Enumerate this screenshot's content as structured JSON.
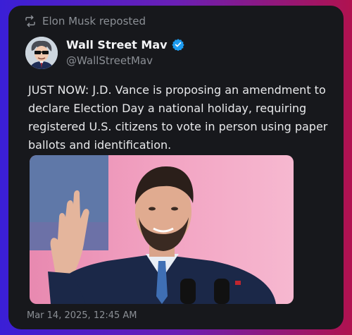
{
  "repost": {
    "label": "Elon Musk reposted",
    "icon": "repost-icon"
  },
  "author": {
    "name": "Wall Street Mav",
    "handle": "@WallStreetMav",
    "verified": true,
    "verified_color": "#1d9bf0"
  },
  "tweet": {
    "text": "JUST NOW: J.D. Vance is proposing an amendment to declare Election Day a national holiday, requiring registered U.S. citizens to vote in person using paper ballots and identification.",
    "timestamp": "Mar 14, 2025, 12:45 AM"
  },
  "colors": {
    "card_bg": "#17181c",
    "text": "#e8e9eb",
    "muted": "#8b8f95"
  }
}
